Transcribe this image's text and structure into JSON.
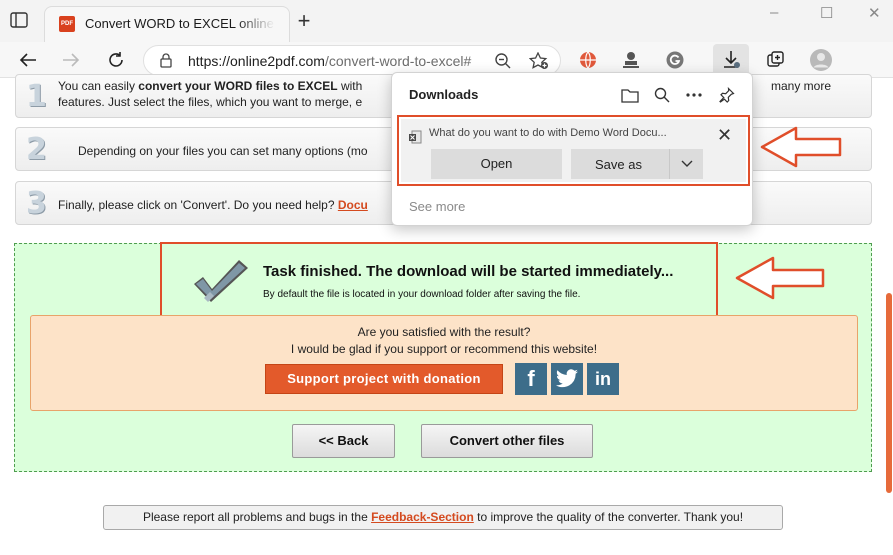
{
  "browser": {
    "tab_title": "Convert WORD to EXCEL online &",
    "tab_favicon_text": "PDF",
    "new_tab": "+",
    "address_host": "https://online2pdf.com",
    "address_path": "/convert-word-to-excel#",
    "window_controls": {
      "minimize": "–",
      "maximize": "☐",
      "close": "✕"
    }
  },
  "downloads": {
    "title": "Downloads",
    "item_question": "What do you want to do with Demo Word Docu...",
    "open_label": "Open",
    "save_as_label": "Save as",
    "see_more": "See more"
  },
  "steps": [
    {
      "number": "1",
      "text_line1_pre": "You can easily ",
      "text_line1_bold": "convert your WORD files to EXCEL",
      "text_line1_post": " with",
      "text_line1_end": "many more",
      "text_line2": "features. Just select the files, which you want to merge, e"
    },
    {
      "number": "2",
      "text": "Depending on your files you can set many options (mo"
    },
    {
      "number": "3",
      "text_pre": "Finally, please click on 'Convert'. Do you need help? ",
      "link": "Docu"
    }
  ],
  "result": {
    "task_title": "Task finished. The download will be started immediately...",
    "task_subtitle": "By default the file is located in your download folder after saving the file.",
    "support_line1": "Are you satisfied with the result?",
    "support_line2": "I would be glad if you support or recommend this website!",
    "donate_label": "Support project with donation",
    "back_label": "<< Back",
    "convert_other_label": "Convert other files"
  },
  "feedback": {
    "pre": "Please report all problems and bugs in the ",
    "link": "Feedback-Section",
    "post": " to improve the quality of the converter. Thank you!"
  },
  "colors": {
    "accent": "#e04e2a",
    "result_bg": "#dbffdb",
    "support_bg": "#fde3c8",
    "donate": "#e35a2b"
  }
}
